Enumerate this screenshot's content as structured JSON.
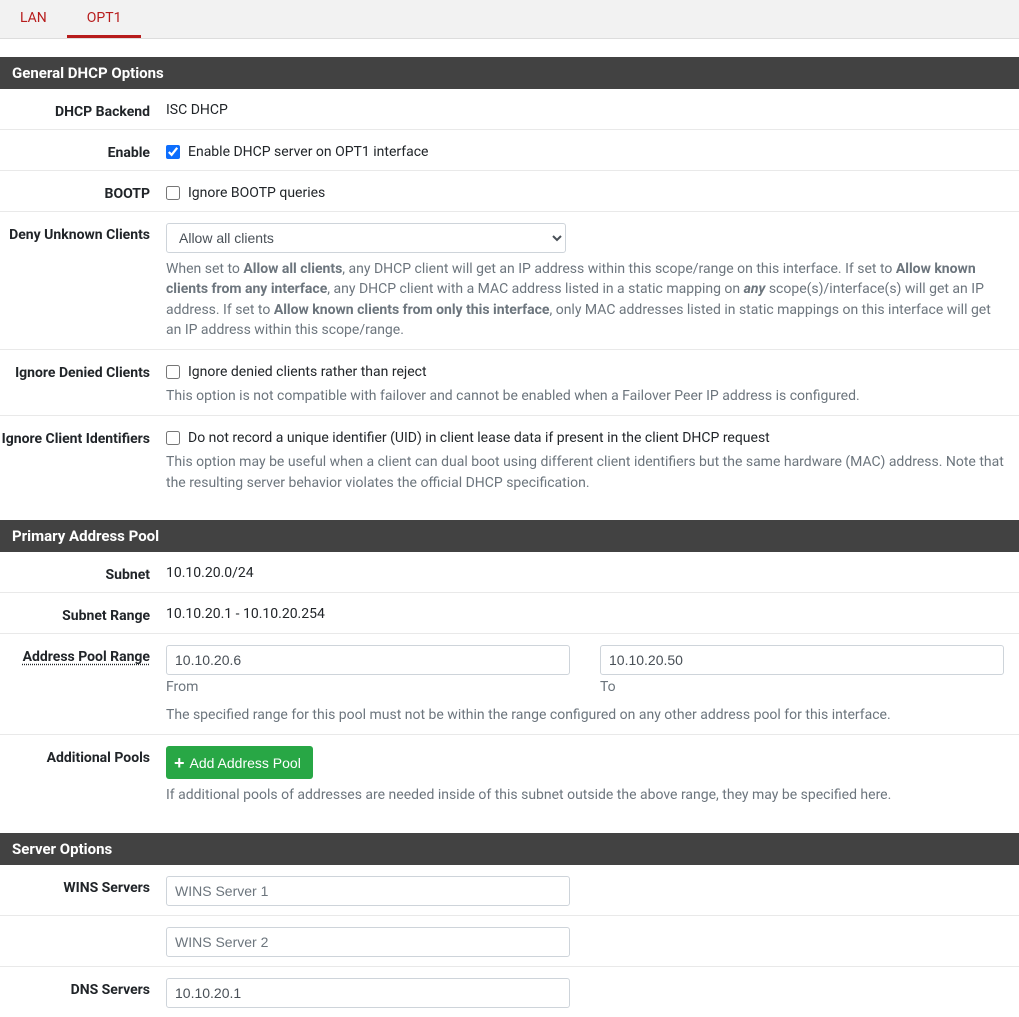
{
  "tabs": {
    "lan": "LAN",
    "opt1": "OPT1"
  },
  "general": {
    "title": "General DHCP Options",
    "backend_label": "DHCP Backend",
    "backend_value": "ISC DHCP",
    "enable_label": "Enable",
    "enable_check": "Enable DHCP server on OPT1 interface",
    "bootp_label": "BOOTP",
    "bootp_check": "Ignore BOOTP queries",
    "deny_label": "Deny Unknown Clients",
    "deny_option": "Allow all clients",
    "deny_help_1": "When set to ",
    "deny_help_2": "Allow all clients",
    "deny_help_3": ", any DHCP client will get an IP address within this scope/range on this interface. If set to ",
    "deny_help_4": "Allow known clients from any interface",
    "deny_help_5": ", any DHCP client with a MAC address listed in a static mapping on ",
    "deny_help_6": "any",
    "deny_help_7": " scope(s)/interface(s) will get an IP address. If set to ",
    "deny_help_8": "Allow known clients from only this interface",
    "deny_help_9": ", only MAC addresses listed in static mappings on this interface will get an IP address within this scope/range.",
    "ignore_denied_label": "Ignore Denied Clients",
    "ignore_denied_check": "Ignore denied clients rather than reject",
    "ignore_denied_help": "This option is not compatible with failover and cannot be enabled when a Failover Peer IP address is configured.",
    "ignore_cid_label": "Ignore Client Identifiers",
    "ignore_cid_check": "Do not record a unique identifier (UID) in client lease data if present in the client DHCP request",
    "ignore_cid_help": "This option may be useful when a client can dual boot using different client identifiers but the same hardware (MAC) address. Note that the resulting server behavior violates the official DHCP specification."
  },
  "pool": {
    "title": "Primary Address Pool",
    "subnet_label": "Subnet",
    "subnet_value": "10.10.20.0/24",
    "subnet_range_label": "Subnet Range",
    "subnet_range_value": "10.10.20.1 - 10.10.20.254",
    "pool_range_label": "Address Pool Range",
    "from_value": "10.10.20.6",
    "from_label": "From",
    "to_value": "10.10.20.50",
    "to_label": "To",
    "pool_help": "The specified range for this pool must not be within the range configured on any other address pool for this interface.",
    "additional_label": "Additional Pools",
    "add_pool_btn": "Add Address Pool",
    "additional_help": "If additional pools of addresses are needed inside of this subnet outside the above range, they may be specified here."
  },
  "server": {
    "title": "Server Options",
    "wins_label": "WINS Servers",
    "wins1_ph": "WINS Server 1",
    "wins2_ph": "WINS Server 2",
    "dns_label": "DNS Servers",
    "dns1_value": "10.10.20.1"
  }
}
